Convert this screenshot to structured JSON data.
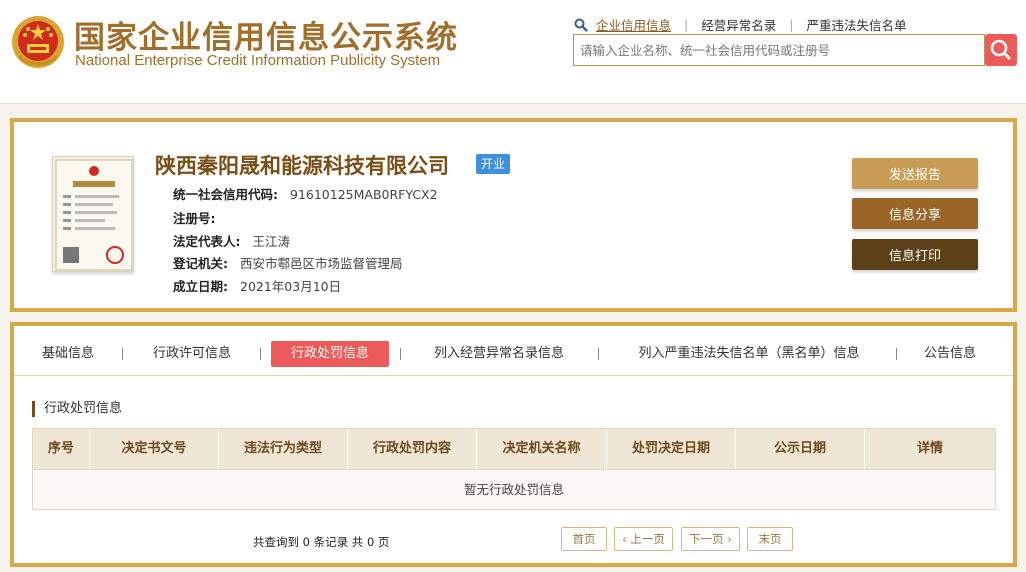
{
  "header": {
    "title": "国家企业信用信息公示系统",
    "subtitle": "National Enterprise Credit Information Publicity System",
    "links": [
      "企业信用信息",
      "经营异常名录",
      "严重违法失信名单"
    ],
    "search_placeholder": "请输入企业名称、统一社会信用代码或注册号"
  },
  "company": {
    "name": "陕西秦阳晟和能源科技有限公司",
    "status": "开业",
    "fields": [
      {
        "label": "统一社会信用代码:",
        "value": "91610125MAB0RFYCX2"
      },
      {
        "label": "注册号:",
        "value": ""
      },
      {
        "label": "法定代表人:",
        "value": "王江涛"
      },
      {
        "label": "登记机关:",
        "value": "西安市鄠邑区市场监督管理局"
      },
      {
        "label": "成立日期:",
        "value": "2021年03月10日"
      }
    ],
    "actions": [
      "发送报告",
      "信息分享",
      "信息打印"
    ]
  },
  "tabs": [
    "基础信息",
    "行政许可信息",
    "行政处罚信息",
    "列入经营异常名录信息",
    "列入严重违法失信名单（黑名单）信息",
    "公告信息"
  ],
  "active_tab": "行政处罚信息",
  "section": {
    "title": "行政处罚信息",
    "columns": [
      "序号",
      "决定书文号",
      "违法行为类型",
      "行政处罚内容",
      "决定机关名称",
      "处罚决定日期",
      "公示日期",
      "详情"
    ],
    "empty_text": "暂无行政处罚信息"
  },
  "pagination": {
    "summary": "共查询到 0 条记录 共 0 页",
    "first": "首页",
    "prev": "上一页",
    "next": "下一页",
    "last": "末页"
  },
  "colors": {
    "accent_gold": "#d6a94a",
    "title_brown": "#a26f2a",
    "active_red": "#ec5a5a",
    "badge_blue": "#3f8fdf"
  },
  "icons": [
    "national-emblem-icon",
    "search-icon",
    "magnifier-icon",
    "business-license-image"
  ]
}
